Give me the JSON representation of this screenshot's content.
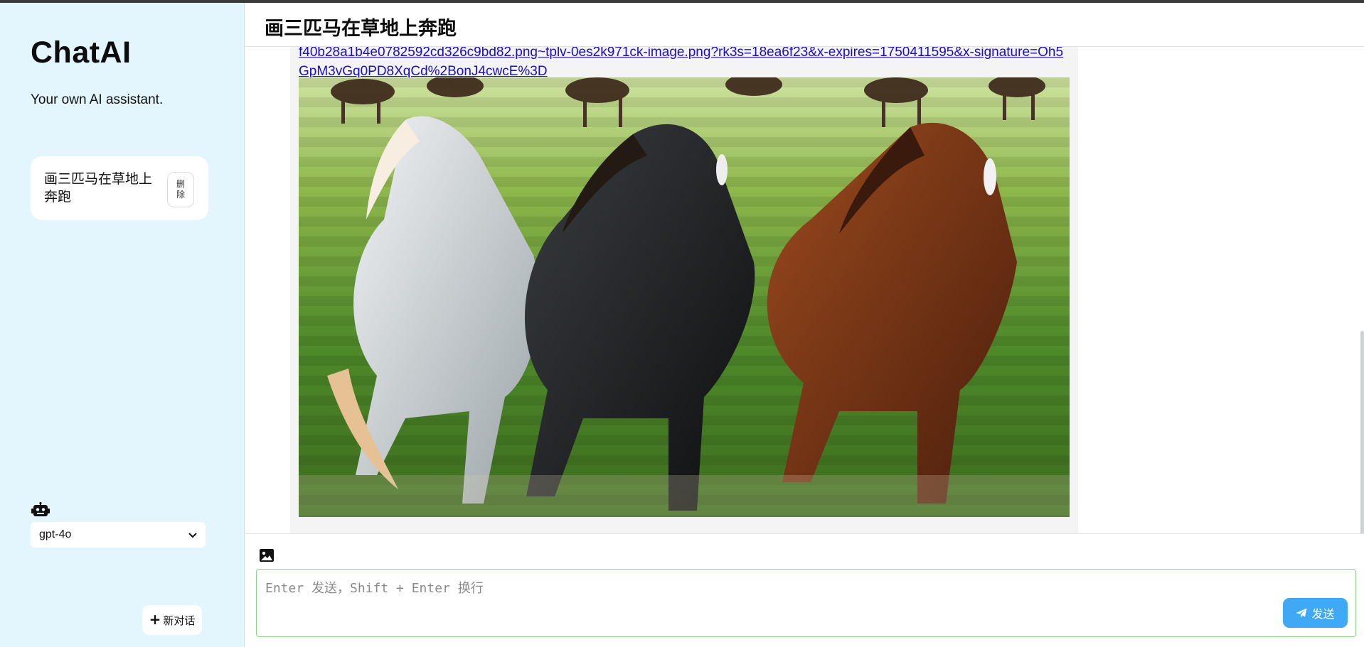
{
  "sidebar": {
    "brand": "ChatAI",
    "tagline": "Your own AI assistant.",
    "conversations": [
      {
        "title": "画三匹马在草地上奔跑",
        "delete_label": "删除"
      }
    ],
    "model": {
      "selected": "gpt-4o",
      "options": [
        "gpt-4o"
      ]
    },
    "new_chat_label": "新对话"
  },
  "header": {
    "title": "画三匹马在草地上奔跑"
  },
  "message": {
    "link_text": "f40b28a1b4e0782592cd326c9bd82.png~tplv-0es2k971ck-image.png?rk3s=18ea6f23&x-expires=1750411595&x-signature=Oh5GpM3vGq0PD8XqCd%2BonJ4cwcE%3D",
    "image_alt": "三匹马在草地上奔跑"
  },
  "composer": {
    "placeholder": "Enter 发送，Shift + Enter 换行",
    "send_label": "发送"
  },
  "icons": {
    "robot": "robot-icon",
    "image_upload": "image-icon",
    "send": "paper-plane-icon",
    "plus": "plus-icon"
  },
  "colors": {
    "sidebar_bg": "#e3f5fd",
    "send_button": "#3fa9f5",
    "input_border": "#8fd48a",
    "link": "#1a0dcd"
  }
}
